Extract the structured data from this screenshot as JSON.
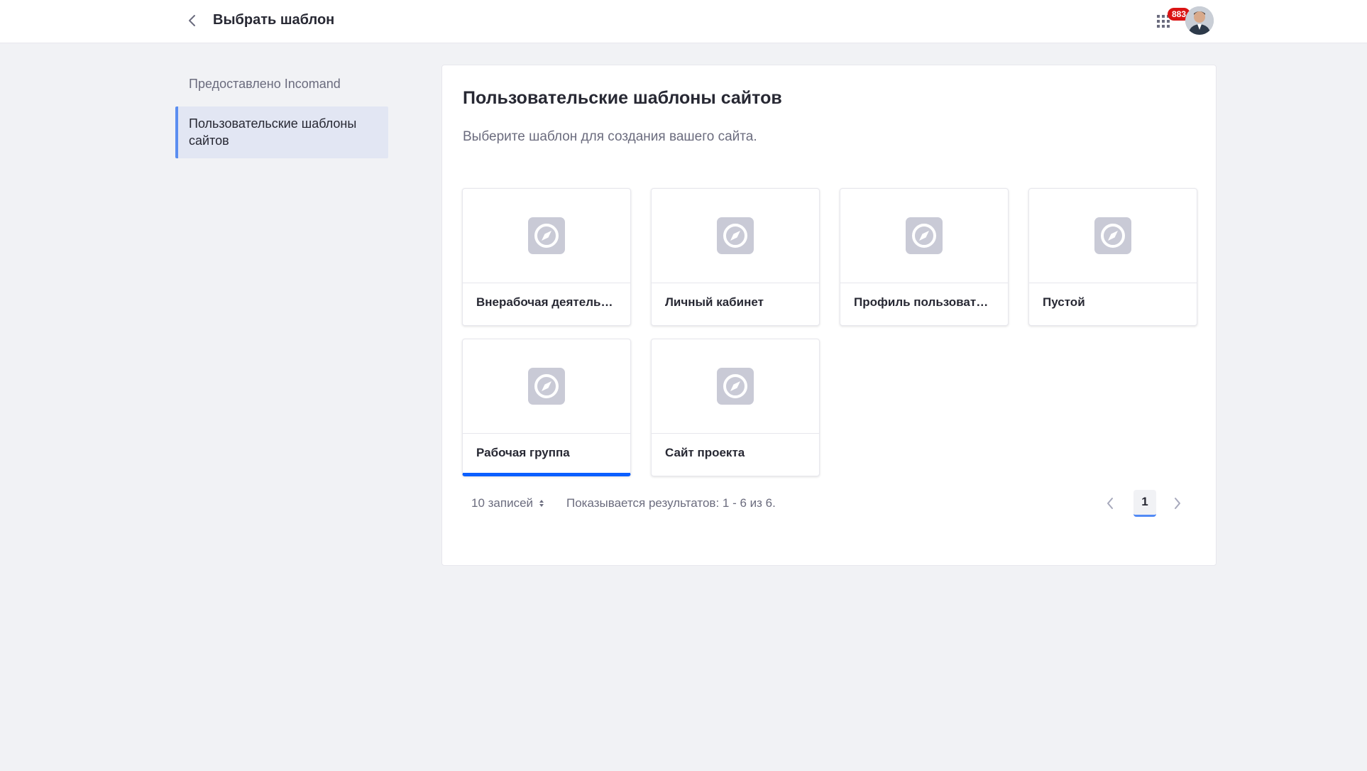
{
  "header": {
    "title": "Выбрать шаблон",
    "notifications_count": "883"
  },
  "sidebar": {
    "items": [
      {
        "label": "Предоставлено Incomand",
        "active": false
      },
      {
        "label": "Пользовательские шаблоны сайтов",
        "active": true
      }
    ]
  },
  "main": {
    "title": "Пользовательские шаблоны сайтов",
    "description": "Выберите шаблон для создания вашего сайта.",
    "templates": [
      {
        "label": "Внерабочая деятельность",
        "selected": false
      },
      {
        "label": "Личный кабинет",
        "selected": false
      },
      {
        "label": "Профиль пользователя",
        "selected": false
      },
      {
        "label": "Пустой",
        "selected": false
      },
      {
        "label": "Рабочая группа",
        "selected": true
      },
      {
        "label": "Сайт проекта",
        "selected": false
      }
    ],
    "per_page": "10 записей",
    "results_text": "Показывается результатов: 1 - 6 из 6.",
    "pagination": {
      "current_page": "1"
    }
  },
  "colors": {
    "accent": "#0b5fff",
    "sidebar_active_bg": "#e2e6f3",
    "sidebar_active_border": "#5b8ef0",
    "badge": "#da1414",
    "page_bg": "#f1f2f5"
  },
  "icons": {
    "back": "chevron-left-icon",
    "apps": "apps-grid-icon",
    "template_placeholder": "compass-icon",
    "sort": "sort-arrows-icon",
    "prev": "chevron-left-icon",
    "next": "chevron-right-icon"
  }
}
